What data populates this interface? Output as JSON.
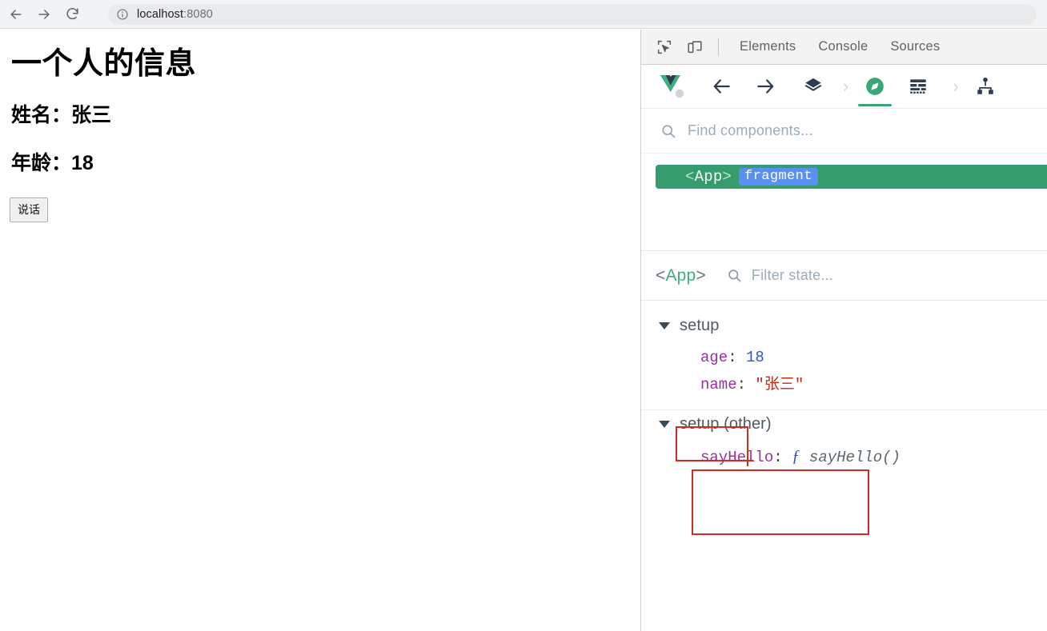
{
  "browser": {
    "back_icon": "arrow-left-icon",
    "forward_icon": "arrow-right-icon",
    "reload_icon": "reload-icon",
    "site_info_icon": "info-circle-icon",
    "url_host": "localhost",
    "url_port": ":8080",
    "url_full": "localhost:8080"
  },
  "page": {
    "title": "一个人的信息",
    "name_line": "姓名：张三",
    "age_line": "年龄：18",
    "button_label": "说话"
  },
  "devtools": {
    "inspect_icon": "inspect-element-icon",
    "device_toolbar_icon": "device-toolbar-icon",
    "tabs": [
      {
        "label": "Elements",
        "active": false
      },
      {
        "label": "Console",
        "active": false
      },
      {
        "label": "Sources",
        "active": false
      }
    ]
  },
  "vue_devtools": {
    "logo_icon": "vue-logo-icon",
    "toolbar": [
      {
        "name": "back-icon",
        "label": "back"
      },
      {
        "name": "forward-icon",
        "label": "forward"
      },
      {
        "name": "components-layers-icon",
        "label": "components"
      },
      {
        "name": "chevron-right-icon",
        "label": ""
      },
      {
        "name": "timeline-compass-icon",
        "label": "timeline",
        "active": true
      },
      {
        "name": "list-rows-icon",
        "label": "rows"
      },
      {
        "name": "chevron-right-icon",
        "label": ""
      },
      {
        "name": "sitemap-icon",
        "label": "sitemap"
      }
    ],
    "search": {
      "icon": "search-icon",
      "placeholder": "Find components..."
    },
    "tree": {
      "selected_component": "App",
      "bracket_open": "<",
      "bracket_close": ">",
      "badge": "fragment"
    },
    "inspector": {
      "component_open": "<",
      "component_name": "App",
      "component_close": ">",
      "filter_icon": "search-icon",
      "filter_placeholder": "Filter state...",
      "groups": [
        {
          "label": "setup",
          "expanded": true,
          "entries": [
            {
              "key": "age",
              "value": "18",
              "type": "number"
            },
            {
              "key": "name",
              "value": "\"张三\"",
              "type": "string"
            }
          ]
        },
        {
          "label": "setup (other)",
          "expanded": true,
          "entries": [
            {
              "key": "sayHello",
              "fn_mark": "ƒ",
              "value": "sayHello()",
              "type": "function"
            }
          ]
        }
      ]
    },
    "annotations": {
      "setup_box": "red-highlight-rect-setup",
      "state_box": "red-highlight-rect-state",
      "plus_mark": "red-plus-mark"
    }
  },
  "colors": {
    "vue_green": "#3eaf7c",
    "selected_row_green": "#359c6d",
    "fragment_badge_blue": "#5c90f0",
    "annotation_red": "#d42a20",
    "key_purple": "#9b2fa0",
    "number_blue": "#2f56c4",
    "string_red": "#c32a18"
  }
}
